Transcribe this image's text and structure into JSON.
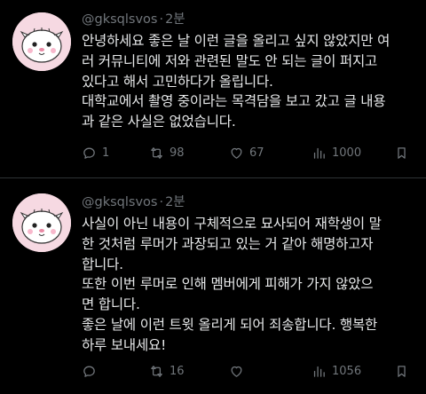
{
  "colors": {
    "background": "#000000",
    "text": "#e7e9ea",
    "muted": "#71767b",
    "avatar_bg": "#f6d9e2"
  },
  "tweets": [
    {
      "handle": "@gksqlsvos",
      "separator": "·",
      "time": "2분",
      "lines": [
        "안녕하세요 좋은 날 이런 글을 올리고 싶지 않았지만 여",
        "러 커뮤니티에 저와 관련된 말도 안 되는 글이 퍼지고",
        "있다고 해서 고민하다가 올립니다.",
        "대학교에서 촬영 중이라는 목격담을 보고 갔고 글 내용",
        "과 같은 사실은 없었습니다."
      ],
      "actions": {
        "replies": "1",
        "retweets": "98",
        "likes": "67",
        "views": "1000"
      },
      "icons": [
        "reply-icon",
        "retweet-icon",
        "like-icon",
        "views-icon",
        "bookmark-icon"
      ]
    },
    {
      "handle": "@gksqlsvos",
      "separator": "·",
      "time": "2분",
      "lines": [
        "사실이 아닌 내용이 구체적으로 묘사되어 재학생이 말",
        "한 것처럼 루머가 과장되고 있는 거 같아 해명하고자",
        "합니다.",
        "또한 이번 루머로 인해 멤버에게 피해가 가지 않았으",
        "면 합니다.",
        "좋은 날에 이런 트윗 올리게 되어 죄송합니다. 행복한",
        "하루 보내세요!"
      ],
      "actions": {
        "replies": "",
        "retweets": "16",
        "likes": "",
        "views": "1056"
      },
      "icons": [
        "reply-icon",
        "retweet-icon",
        "like-icon",
        "views-icon",
        "bookmark-icon"
      ]
    }
  ]
}
